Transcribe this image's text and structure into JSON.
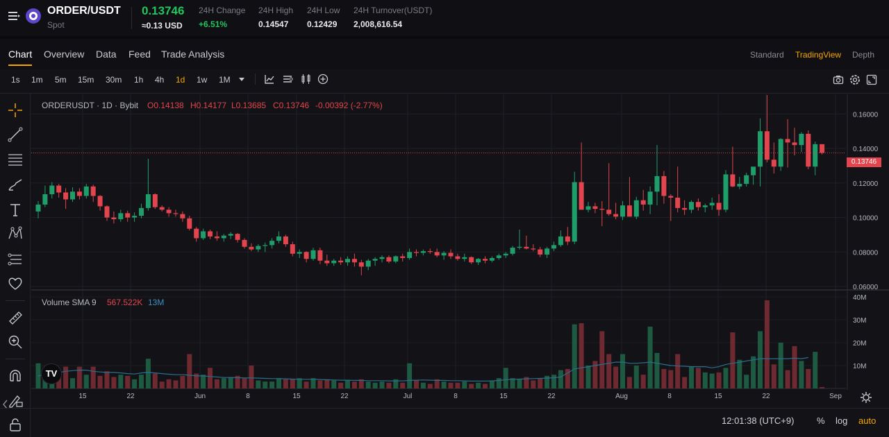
{
  "header": {
    "pair": "ORDER/USDT",
    "market": "Spot",
    "last_price": "0.13746",
    "usd_price": "≈0.13 USD",
    "stats": [
      {
        "label": "24H Change",
        "value": "+6.51%"
      },
      {
        "label": "24H High",
        "value": "0.14547"
      },
      {
        "label": "24H Low",
        "value": "0.12429"
      },
      {
        "label": "24H Turnover(USDT)",
        "value": "2,008,616.54"
      }
    ]
  },
  "tabs": [
    "Chart",
    "Overview",
    "Data",
    "Feed",
    "Trade Analysis"
  ],
  "views": [
    "Standard",
    "TradingView",
    "Depth"
  ],
  "timeframes": [
    "1s",
    "1m",
    "5m",
    "15m",
    "30m",
    "1h",
    "4h",
    "1d",
    "1w",
    "1M"
  ],
  "active_timeframe": "1d",
  "legend": {
    "symbol": "ORDERUSDT · 1D · Bybit",
    "open": "O0.14138",
    "high": "H0.14177",
    "low": "L0.13685",
    "close": "C0.13746",
    "change": "-0.00392 (-2.77%)"
  },
  "volume_legend": {
    "name": "Volume SMA 9",
    "value": "567.522K",
    "sma": "13M"
  },
  "price_label": "0.13746",
  "footer": {
    "time": "12:01:38 (UTC+9)",
    "percent": "%",
    "log": "log",
    "auto": "auto"
  },
  "colors": {
    "up": "#1f9e6c",
    "down": "#e2454e",
    "accent": "#f7a600",
    "vol_up": "#1e5a42",
    "vol_down": "#6e2a30",
    "sma": "#2a6f8f"
  },
  "chart_data": {
    "type": "candlestick",
    "y_ticks": [
      "0.06000",
      "0.08000",
      "0.10000",
      "0.12000",
      "0.14000",
      "0.16000"
    ],
    "ylim": [
      0.058,
      0.1714
    ],
    "vol_ticks": [
      "10M",
      "20M",
      "30M",
      "40M"
    ],
    "vol_ylim": [
      0,
      40
    ],
    "x_ticks": [
      "15",
      "22",
      "Jun",
      "8",
      "15",
      "22",
      "Jul",
      "8",
      "15",
      "22",
      "Aug",
      "8",
      "15",
      "22",
      "Sep"
    ],
    "candles": [
      [
        0.1035,
        0.1095,
        0.0995,
        0.1075,
        11.0
      ],
      [
        0.1075,
        0.1185,
        0.106,
        0.1135,
        8.0
      ],
      [
        0.1135,
        0.1205,
        0.111,
        0.1185,
        9.0
      ],
      [
        0.1185,
        0.1195,
        0.1115,
        0.1145,
        5.5
      ],
      [
        0.1145,
        0.117,
        0.105,
        0.1105,
        9.5
      ],
      [
        0.1105,
        0.1175,
        0.109,
        0.115,
        4.5
      ],
      [
        0.115,
        0.117,
        0.1105,
        0.1125,
        9.5
      ],
      [
        0.1125,
        0.1195,
        0.111,
        0.118,
        6.0
      ],
      [
        0.118,
        0.119,
        0.109,
        0.1125,
        9.5
      ],
      [
        0.1125,
        0.113,
        0.104,
        0.1065,
        5.5
      ],
      [
        0.1065,
        0.107,
        0.098,
        0.1,
        7.5
      ],
      [
        0.1,
        0.1035,
        0.0965,
        0.099,
        5.0
      ],
      [
        0.099,
        0.1045,
        0.0975,
        0.1025,
        6.0
      ],
      [
        0.1025,
        0.104,
        0.0975,
        0.1,
        5.5
      ],
      [
        0.1,
        0.103,
        0.0975,
        0.101,
        4.0
      ],
      [
        0.101,
        0.108,
        0.0995,
        0.1055,
        6.0
      ],
      [
        0.1055,
        0.134,
        0.104,
        0.1135,
        13.0
      ],
      [
        0.1135,
        0.114,
        0.105,
        0.106,
        6.5
      ],
      [
        0.106,
        0.107,
        0.1035,
        0.1045,
        3.0
      ],
      [
        0.1045,
        0.106,
        0.1005,
        0.1025,
        4.0
      ],
      [
        0.1025,
        0.1045,
        0.1005,
        0.102,
        3.5
      ],
      [
        0.102,
        0.1035,
        0.0975,
        0.0995,
        5.5
      ],
      [
        0.0995,
        0.101,
        0.0925,
        0.0935,
        15.0
      ],
      [
        0.0935,
        0.0945,
        0.086,
        0.088,
        6.5
      ],
      [
        0.088,
        0.0935,
        0.087,
        0.092,
        6.0
      ],
      [
        0.092,
        0.093,
        0.0875,
        0.089,
        9.0
      ],
      [
        0.089,
        0.092,
        0.0865,
        0.088,
        4.0
      ],
      [
        0.088,
        0.0905,
        0.086,
        0.0895,
        4.5
      ],
      [
        0.0895,
        0.0915,
        0.0875,
        0.0905,
        5.0
      ],
      [
        0.0905,
        0.091,
        0.0855,
        0.087,
        5.5
      ],
      [
        0.087,
        0.088,
        0.082,
        0.083,
        4.5
      ],
      [
        0.083,
        0.085,
        0.0805,
        0.0815,
        10.0
      ],
      [
        0.0815,
        0.0845,
        0.08,
        0.0835,
        3.5
      ],
      [
        0.0835,
        0.0855,
        0.08,
        0.084,
        3.0
      ],
      [
        0.084,
        0.088,
        0.082,
        0.0865,
        3.0
      ],
      [
        0.0865,
        0.092,
        0.085,
        0.089,
        4.5
      ],
      [
        0.089,
        0.09,
        0.083,
        0.0845,
        4.0
      ],
      [
        0.0845,
        0.086,
        0.0775,
        0.079,
        4.0
      ],
      [
        0.079,
        0.0815,
        0.0765,
        0.08,
        4.5
      ],
      [
        0.08,
        0.0805,
        0.074,
        0.076,
        3.0
      ],
      [
        0.076,
        0.0825,
        0.075,
        0.081,
        4.5
      ],
      [
        0.081,
        0.0825,
        0.073,
        0.075,
        3.5
      ],
      [
        0.075,
        0.0785,
        0.072,
        0.0735,
        4.0
      ],
      [
        0.0735,
        0.076,
        0.072,
        0.075,
        3.5
      ],
      [
        0.075,
        0.077,
        0.0725,
        0.074,
        2.5
      ],
      [
        0.074,
        0.0775,
        0.072,
        0.076,
        3.5
      ],
      [
        0.076,
        0.079,
        0.0715,
        0.074,
        3.0
      ],
      [
        0.074,
        0.0755,
        0.0665,
        0.0715,
        4.0
      ],
      [
        0.0715,
        0.076,
        0.0695,
        0.075,
        3.0
      ],
      [
        0.075,
        0.077,
        0.072,
        0.076,
        2.5
      ],
      [
        0.076,
        0.078,
        0.074,
        0.077,
        3.0
      ],
      [
        0.077,
        0.078,
        0.0735,
        0.0745,
        2.5
      ],
      [
        0.0745,
        0.078,
        0.0735,
        0.0775,
        4.0
      ],
      [
        0.0775,
        0.079,
        0.0745,
        0.0765,
        2.5
      ],
      [
        0.0765,
        0.082,
        0.0755,
        0.08,
        11.0
      ],
      [
        0.08,
        0.0815,
        0.0775,
        0.0795,
        3.5
      ],
      [
        0.0795,
        0.0815,
        0.078,
        0.0805,
        2.5
      ],
      [
        0.0805,
        0.082,
        0.079,
        0.08,
        2.0
      ],
      [
        0.08,
        0.082,
        0.077,
        0.078,
        4.0
      ],
      [
        0.078,
        0.0805,
        0.0755,
        0.0795,
        3.0
      ],
      [
        0.0795,
        0.0815,
        0.076,
        0.0775,
        2.5
      ],
      [
        0.0775,
        0.079,
        0.075,
        0.076,
        2.5
      ],
      [
        0.076,
        0.079,
        0.0745,
        0.077,
        3.0
      ],
      [
        0.077,
        0.0775,
        0.073,
        0.074,
        2.0
      ],
      [
        0.074,
        0.0765,
        0.0725,
        0.076,
        2.5
      ],
      [
        0.076,
        0.0775,
        0.0735,
        0.075,
        2.0
      ],
      [
        0.075,
        0.0775,
        0.074,
        0.0765,
        3.5
      ],
      [
        0.0765,
        0.079,
        0.0755,
        0.078,
        4.5
      ],
      [
        0.078,
        0.08,
        0.0765,
        0.079,
        9.0
      ],
      [
        0.079,
        0.0835,
        0.078,
        0.0825,
        4.5
      ],
      [
        0.0825,
        0.093,
        0.0815,
        0.083,
        4.0
      ],
      [
        0.083,
        0.0895,
        0.0815,
        0.082,
        5.0
      ],
      [
        0.082,
        0.0845,
        0.0805,
        0.0815,
        3.5
      ],
      [
        0.0815,
        0.083,
        0.077,
        0.0785,
        4.5
      ],
      [
        0.0785,
        0.083,
        0.0765,
        0.082,
        5.5
      ],
      [
        0.082,
        0.086,
        0.0805,
        0.084,
        6.0
      ],
      [
        0.084,
        0.0925,
        0.083,
        0.089,
        8.0
      ],
      [
        0.089,
        0.0945,
        0.084,
        0.086,
        8.5
      ],
      [
        0.086,
        0.1265,
        0.0845,
        0.1205,
        28.0
      ],
      [
        0.1205,
        0.1435,
        0.1085,
        0.1045,
        28.5
      ],
      [
        0.1045,
        0.109,
        0.103,
        0.1065,
        10.0
      ],
      [
        0.1065,
        0.1085,
        0.1025,
        0.105,
        12.0
      ],
      [
        0.105,
        0.1095,
        0.095,
        0.1045,
        25.0
      ],
      [
        0.1045,
        0.1315,
        0.101,
        0.102,
        15.0
      ],
      [
        0.102,
        0.1085,
        0.099,
        0.1005,
        9.5
      ],
      [
        0.1005,
        0.1095,
        0.0985,
        0.107,
        15.0
      ],
      [
        0.107,
        0.1235,
        0.104,
        0.1005,
        5.0
      ],
      [
        0.1005,
        0.112,
        0.099,
        0.11,
        10.0
      ],
      [
        0.11,
        0.116,
        0.104,
        0.1075,
        6.0
      ],
      [
        0.1075,
        0.118,
        0.102,
        0.115,
        27.0
      ],
      [
        0.115,
        0.142,
        0.107,
        0.124,
        15.5
      ],
      [
        0.124,
        0.127,
        0.108,
        0.1125,
        8.5
      ],
      [
        0.1125,
        0.1135,
        0.098,
        0.1115,
        8.0
      ],
      [
        0.1115,
        0.1295,
        0.103,
        0.1055,
        15.0
      ],
      [
        0.1055,
        0.11,
        0.1015,
        0.1045,
        5.0
      ],
      [
        0.1045,
        0.11,
        0.1025,
        0.109,
        9.5
      ],
      [
        0.109,
        0.111,
        0.104,
        0.106,
        9.0
      ],
      [
        0.106,
        0.108,
        0.103,
        0.107,
        7.0
      ],
      [
        0.107,
        0.1115,
        0.1045,
        0.1085,
        6.5
      ],
      [
        0.1085,
        0.1135,
        0.101,
        0.1045,
        7.0
      ],
      [
        0.1045,
        0.1275,
        0.103,
        0.125,
        9.0
      ],
      [
        0.125,
        0.141,
        0.1175,
        0.118,
        24.5
      ],
      [
        0.118,
        0.1235,
        0.1165,
        0.1195,
        12.5
      ],
      [
        0.1195,
        0.126,
        0.118,
        0.1245,
        6.0
      ],
      [
        0.1245,
        0.128,
        0.119,
        0.1295,
        14.0
      ],
      [
        0.1295,
        0.1575,
        0.118,
        0.15,
        25.0
      ],
      [
        0.15,
        0.171,
        0.132,
        0.1335,
        38.5
      ],
      [
        0.1335,
        0.1435,
        0.1255,
        0.1295,
        10.5
      ],
      [
        0.1295,
        0.146,
        0.127,
        0.1455,
        20.0
      ],
      [
        0.1455,
        0.157,
        0.129,
        0.1435,
        8.0
      ],
      [
        0.1435,
        0.152,
        0.136,
        0.142,
        18.5
      ],
      [
        0.142,
        0.1495,
        0.138,
        0.1485,
        12.0
      ],
      [
        0.1485,
        0.1505,
        0.128,
        0.1295,
        8.5
      ],
      [
        0.1295,
        0.144,
        0.1245,
        0.1425,
        16.0
      ],
      [
        0.1425,
        0.142,
        0.1365,
        0.1375,
        0.6
      ]
    ],
    "sma": [
      5.5,
      6.0,
      6.5,
      7.0,
      7.5,
      7.8,
      8.0,
      8.0,
      7.5,
      7.2,
      7.0,
      7.0,
      6.8,
      6.5,
      6.3,
      6.8,
      7.0,
      6.8,
      6.5,
      6.2,
      6.0,
      6.0,
      5.8,
      5.5,
      5.5,
      5.2,
      5.0,
      4.8,
      4.8,
      4.7,
      4.6,
      4.6,
      4.5,
      4.4,
      4.3,
      4.3,
      4.2,
      4.1,
      4.0,
      4.0,
      4.0,
      3.9,
      3.8,
      3.7,
      3.6,
      3.6,
      3.5,
      3.5,
      3.4,
      3.4,
      3.4,
      3.3,
      3.3,
      3.3,
      3.5,
      3.6,
      3.7,
      3.6,
      3.5,
      3.5,
      3.4,
      3.4,
      3.3,
      3.2,
      3.2,
      3.2,
      3.3,
      3.5,
      3.8,
      4.0,
      4.1,
      4.2,
      4.3,
      4.4,
      4.5,
      4.7,
      5.0,
      6.8,
      8.5,
      9.0,
      9.5,
      10.0,
      10.5,
      11.0,
      11.5,
      11.5,
      11.0,
      11.0,
      11.2,
      11.5,
      11.0,
      10.5,
      10.0,
      9.8,
      9.7,
      9.5,
      9.5,
      9.5,
      9.0,
      9.5,
      10.5,
      11.0,
      11.5,
      12.0,
      12.5,
      13.0,
      13.0,
      13.0,
      13.0,
      13.0,
      13.2,
      13.0,
      13.5
    ]
  }
}
